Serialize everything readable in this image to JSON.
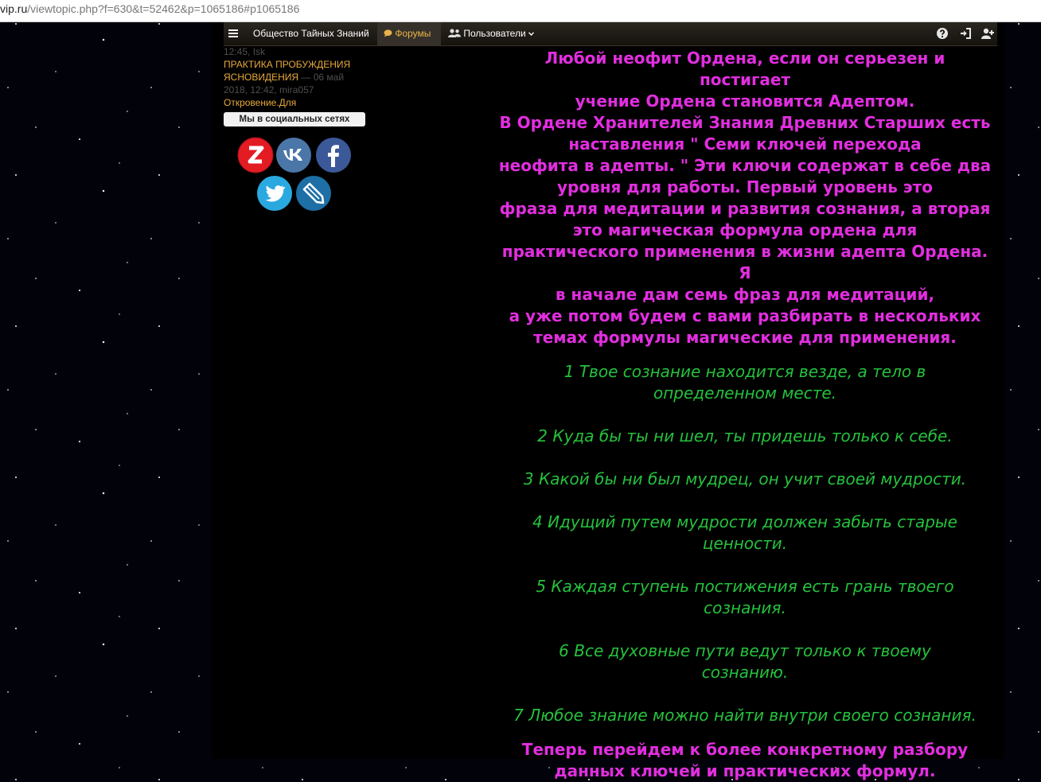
{
  "address_bar": {
    "host": "vip.ru",
    "path": "/viewtopic.php?f=630&t=52462&p=1065186#p1065186"
  },
  "navbar": {
    "site_name": "Общество Тайных Знаний",
    "forums_label": "Форумы",
    "users_label": "Пользователи",
    "icons": [
      "menu-icon",
      "forum-bubble-icon",
      "users-icon",
      "chevron-down-icon",
      "help-icon",
      "login-icon",
      "register-icon"
    ]
  },
  "sidebar": {
    "prev_meta": "12:45, Isk",
    "topic_title": "ПРАКТИКА ПРОБУЖДЕНИЯ ЯСНОВИДЕНИЯ",
    "topic_meta_date": " — 06 май",
    "topic_meta_time": "2018, 12:42, mira057",
    "next_topic": "Откровение.Для",
    "social_heading": "Мы в социальных сетях",
    "social_icons": [
      "zen-icon",
      "vk-icon",
      "facebook-icon",
      "twitter-icon",
      "livejournal-icon"
    ]
  },
  "post": {
    "intro_lines": [
      "Любой неофит Ордена, если он серьезен и постигает",
      "учение Ордена становится Адептом.",
      "В Ордене Хранителей Знания Древних Старших есть",
      "наставления \" Семи ключей перехода",
      "неофита в адепты. \" Эти ключи содержат в себе два",
      "уровня для работы. Первый уровень это",
      "фраза для медитации и развития сознания, а вторая",
      "это магическая формула ордена для",
      "практического применения в жизни адепта Ордена. Я",
      "в начале дам семь фраз для медитаций,",
      "а уже потом будем с вами разбирать в нескольких",
      "темах формулы магические для применения."
    ],
    "phrases": [
      [
        "1 Твое сознание находится везде, а тело в",
        "определенном месте."
      ],
      [
        "2 Куда бы ты ни шел, ты придешь только к себе."
      ],
      [
        "3 Какой бы ни был мудрец, он учит своей мудрости."
      ],
      [
        "4 Идущий путем мудрости должен забыть старые",
        "ценности."
      ],
      [
        "5 Каждая ступень постижения есть грань твоего",
        "сознания."
      ],
      [
        "6 Все духовные пути ведут только к твоему",
        "сознанию."
      ],
      [
        "7 Любое знание можно найти внутри своего сознания."
      ]
    ],
    "outro_lines": [
      "Теперь перейдем к более конкретному разбору",
      "данных ключей и практических формул."
    ]
  },
  "colors": {
    "accent_magenta": "#e22ee0",
    "phrase_green": "#25c13d",
    "link_orange": "#e8a83c"
  }
}
